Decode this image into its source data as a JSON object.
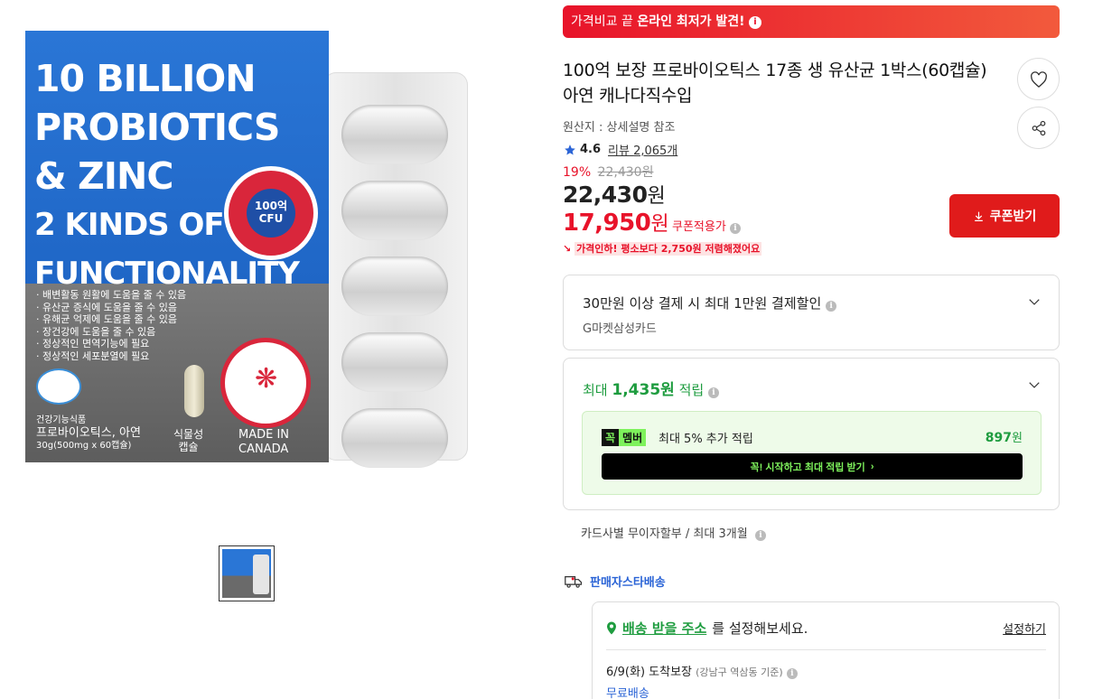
{
  "image": {
    "headline": [
      "10 BILLION",
      "PROBIOTICS",
      "& ZINC",
      "2 KINDS OF",
      "FUNCTIONALITY"
    ],
    "badge_top": "100억",
    "badge_bottom": "CFU",
    "claims": [
      "· 배변활동 원활에 도움을 줄 수 있음",
      "· 유산균 증식에 도움을 줄 수 있음",
      "· 유해균 억제에 도움을 줄 수 있음",
      "· 장건강에 도움을 줄 수 있음",
      "· 정상적인 면역기능에 필요",
      "· 정상적인 세포분열에 필요"
    ],
    "category": "건강기능식품",
    "name": "프로바이오틱스, 아연",
    "spec": "30g(500mg x 60캡슐)",
    "capsule_label": "식물성\n캡슐",
    "made_in": "MADE IN\nCANADA"
  },
  "promo_banner": {
    "prefix": "가격비교 끝",
    "highlight": "온라인 최저가 발견!",
    "icon": "info-icon"
  },
  "product": {
    "title": "100억 보장 프로바이오틱스 17종 생 유산균 1박스(60캡슐) 아연 캐나다직수입",
    "origin": "원산지 : 상세설명 참조",
    "rating": "4.6",
    "reviews_label": "리뷰",
    "reviews_count": "2,065개",
    "discount_pct": "19%",
    "original_price": "22,430원",
    "price": "22,430",
    "price_unit": "원",
    "coupon_price": "17,950",
    "coupon_unit": "원",
    "coupon_label": "쿠폰적용가",
    "price_drop_prefix": "가격인하! 평소보다",
    "price_drop_amount": "2,750원",
    "price_drop_suffix": "저렴해졌어요"
  },
  "coupon_button": {
    "label": "쿠폰받기"
  },
  "card_discount": {
    "title": "30만원 이상 결제 시 최대 1만원 결제할인",
    "subtitle": "G마켓삼성카드"
  },
  "points": {
    "prefix": "최대",
    "amount": "1,435원",
    "suffix": "적립",
    "member_tag_1": "꼭",
    "member_tag_2": "멤버",
    "member_desc": "최대 5% 추가 적립",
    "member_points": "897",
    "member_points_unit": "원",
    "join_label": "꼭! 시작하고 최대 적립 받기"
  },
  "installment": "카드사별 무이자할부 / 최대 3개월",
  "delivery": {
    "brand": "판매자스타배송",
    "address_link": "배송 받을 주소",
    "address_suffix": "를 설정해보세요.",
    "set_label": "설정하기",
    "eta": "6/9(화) 도착보장",
    "eta_note": "(강남구 역삼동 기준)",
    "free": "무료배송"
  },
  "colors": {
    "brand_red": "#e8132a",
    "green": "#1e9c3f",
    "blue": "#2b64d6"
  }
}
